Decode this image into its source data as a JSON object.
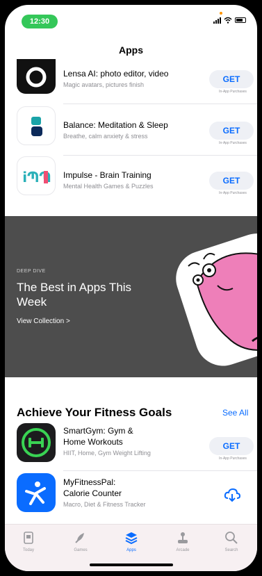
{
  "status": {
    "time": "12:30"
  },
  "nav": {
    "title": "Apps"
  },
  "top_apps": [
    {
      "title": "Lensa AI: photo editor, video",
      "subtitle": "Magic avatars, pictures finish",
      "button": "GET",
      "iap": "In-App Purchases"
    },
    {
      "title": "Balance: Meditation & Sleep",
      "subtitle": "Breathe, calm anxiety & stress",
      "button": "GET",
      "iap": "In-App Purchases"
    },
    {
      "title": "Impulse - Brain Training",
      "subtitle": "Mental Health Games & Puzzles",
      "button": "GET",
      "iap": "In-App Purchases"
    }
  ],
  "banner": {
    "eyebrow": "DEEP DIVE",
    "title": "The Best in Apps This Week",
    "link": "View Collection >"
  },
  "fitness": {
    "title": "Achieve Your Fitness Goals",
    "see_all": "See All",
    "apps": [
      {
        "title_line1": "SmartGym: Gym &",
        "title_line2": "Home Workouts",
        "subtitle": "HIIT, Home, Gym Weight Lifting",
        "button": "GET",
        "iap": "In-App Purchases"
      },
      {
        "title_line1": "MyFitnessPal:",
        "title_line2": "Calorie Counter",
        "subtitle": "Macro, Diet & Fitness Tracker"
      }
    ]
  },
  "tabs": [
    {
      "label": "Today",
      "icon": "today-icon"
    },
    {
      "label": "Games",
      "icon": "rocket-icon"
    },
    {
      "label": "Apps",
      "icon": "layers-icon",
      "active": true
    },
    {
      "label": "Arcade",
      "icon": "joystick-icon"
    },
    {
      "label": "Search",
      "icon": "search-icon"
    }
  ],
  "colors": {
    "accent": "#0a6cff",
    "status_pill": "#34c759",
    "banner_bg": "#4d4d4d",
    "creature": "#ee7fb9"
  }
}
